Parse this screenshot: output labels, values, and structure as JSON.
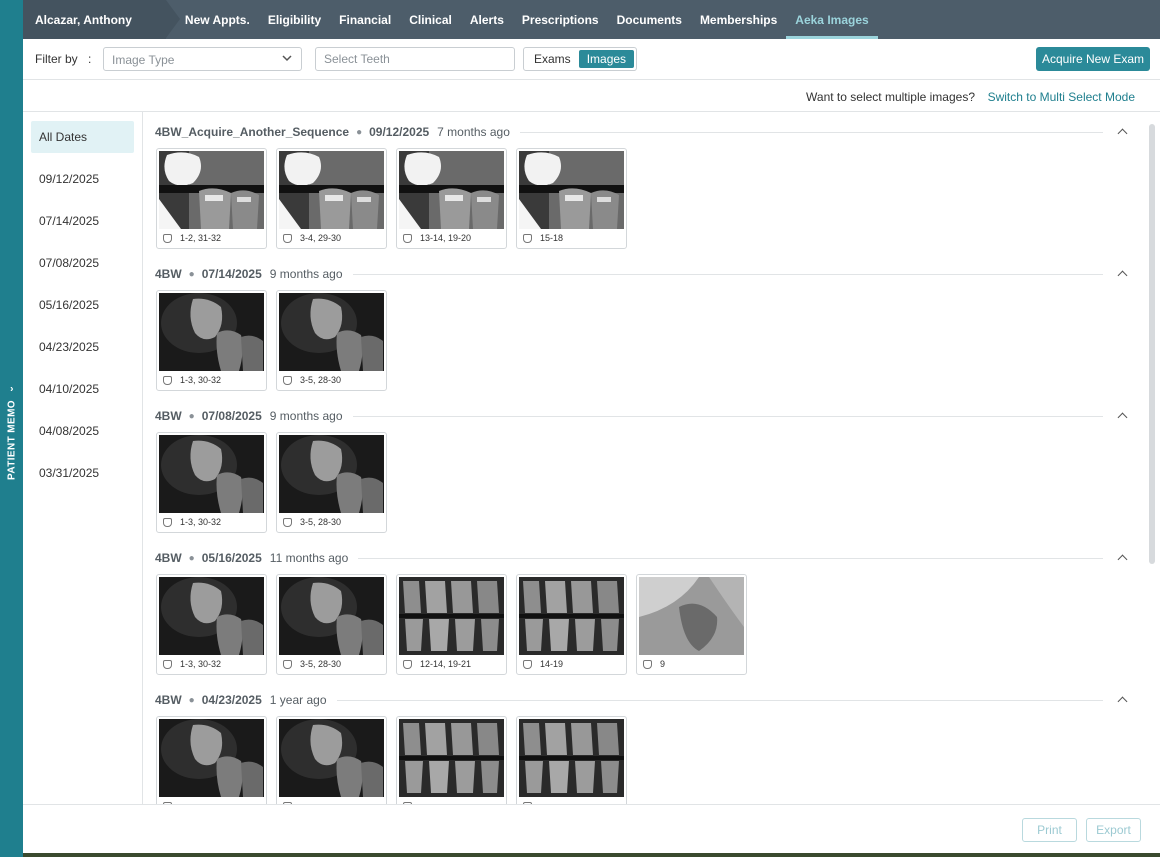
{
  "memo": {
    "label": "PATIENT MEMO"
  },
  "nav": {
    "patient": "Alcazar, Anthony",
    "items": [
      {
        "label": "New Appts.",
        "active": false
      },
      {
        "label": "Eligibility",
        "active": false
      },
      {
        "label": "Financial",
        "active": false
      },
      {
        "label": "Clinical",
        "active": false
      },
      {
        "label": "Alerts",
        "active": false
      },
      {
        "label": "Prescriptions",
        "active": false
      },
      {
        "label": "Documents",
        "active": false
      },
      {
        "label": "Memberships",
        "active": false
      },
      {
        "label": "Aeka Images",
        "active": true
      }
    ]
  },
  "filter": {
    "label": "Filter by",
    "colon": ":",
    "image_type_placeholder": "Image Type",
    "teeth_placeholder": "Select Teeth",
    "toggle_exams": "Exams",
    "toggle_images": "Images",
    "active_toggle": "Images",
    "acquire_label": "Acquire New Exam"
  },
  "multi": {
    "question": "Want to select multiple images?",
    "link": "Switch to Multi Select Mode"
  },
  "dates": [
    "All Dates",
    "09/12/2025",
    "07/14/2025",
    "07/08/2025",
    "05/16/2025",
    "04/23/2025",
    "04/10/2025",
    "04/08/2025",
    "03/31/2025"
  ],
  "active_date": "All Dates",
  "exams": [
    {
      "name": "4BW_Acquire_Another_Sequence",
      "date": "09/12/2025",
      "ago": "7 months ago",
      "images": [
        {
          "teeth": "1-2, 31-32",
          "kind": "bitewing-filling"
        },
        {
          "teeth": "3-4, 29-30",
          "kind": "bitewing-filling"
        },
        {
          "teeth": "13-14, 19-20",
          "kind": "bitewing-filling"
        },
        {
          "teeth": "15-18",
          "kind": "bitewing-filling"
        }
      ]
    },
    {
      "name": "4BW",
      "date": "07/14/2025",
      "ago": "9 months ago",
      "images": [
        {
          "teeth": "1-3, 30-32",
          "kind": "molar-dark"
        },
        {
          "teeth": "3-5, 28-30",
          "kind": "molar-dark"
        }
      ]
    },
    {
      "name": "4BW",
      "date": "07/08/2025",
      "ago": "9 months ago",
      "images": [
        {
          "teeth": "1-3, 30-32",
          "kind": "molar-dark"
        },
        {
          "teeth": "3-5, 28-30",
          "kind": "molar-dark"
        }
      ]
    },
    {
      "name": "4BW",
      "date": "05/16/2025",
      "ago": "11 months ago",
      "images": [
        {
          "teeth": "1-3, 30-32",
          "kind": "molar-dark"
        },
        {
          "teeth": "3-5, 28-30",
          "kind": "molar-dark"
        },
        {
          "teeth": "12-14, 19-21",
          "kind": "row-teeth"
        },
        {
          "teeth": "14-19",
          "kind": "row-teeth"
        },
        {
          "teeth": "9",
          "kind": "single-tooth"
        }
      ]
    },
    {
      "name": "4BW",
      "date": "04/23/2025",
      "ago": "1 year ago",
      "images": [
        {
          "teeth": "",
          "kind": "molar-dark"
        },
        {
          "teeth": "",
          "kind": "molar-dark"
        },
        {
          "teeth": "",
          "kind": "row-teeth"
        },
        {
          "teeth": "",
          "kind": "row-teeth"
        }
      ]
    }
  ],
  "actions": {
    "print": "Print",
    "export": "Export"
  }
}
